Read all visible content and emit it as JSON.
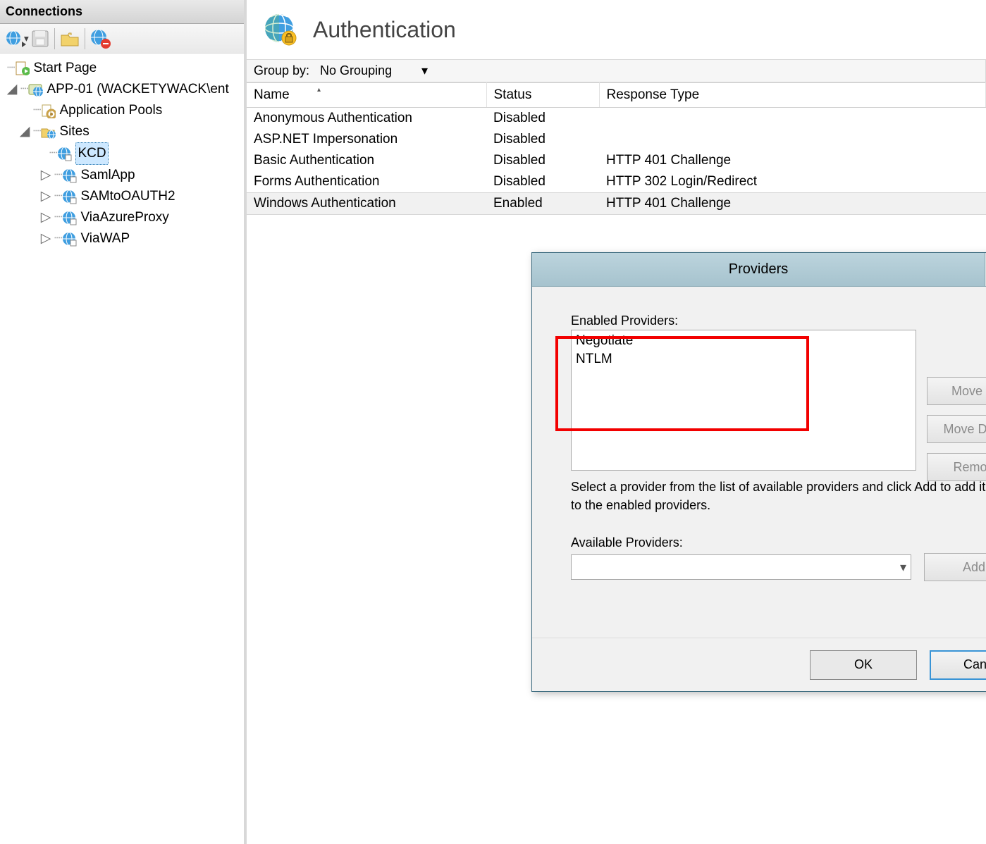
{
  "connections": {
    "header": "Connections",
    "tree": {
      "start_page": "Start Page",
      "server": "APP-01 (WACKETYWACK\\ent",
      "app_pools": "Application Pools",
      "sites_label": "Sites",
      "sites": [
        "KCD",
        "SamlApp",
        "SAMtoOAUTH2",
        "ViaAzureProxy",
        "ViaWAP"
      ]
    }
  },
  "main": {
    "title": "Authentication",
    "group_by_label": "Group by:",
    "group_by_value": "No Grouping",
    "columns": {
      "name": "Name",
      "status": "Status",
      "response": "Response Type"
    },
    "rows": [
      {
        "name": "Anonymous Authentication",
        "status": "Disabled",
        "response": ""
      },
      {
        "name": "ASP.NET Impersonation",
        "status": "Disabled",
        "response": ""
      },
      {
        "name": "Basic Authentication",
        "status": "Disabled",
        "response": "HTTP 401 Challenge"
      },
      {
        "name": "Forms Authentication",
        "status": "Disabled",
        "response": "HTTP 302 Login/Redirect"
      },
      {
        "name": "Windows Authentication",
        "status": "Enabled",
        "response": "HTTP 401 Challenge"
      }
    ]
  },
  "dialog": {
    "title": "Providers",
    "enabled_label": "Enabled Providers:",
    "enabled_items": [
      "Negotiate",
      "NTLM"
    ],
    "instructions": "Select a provider from the list of available providers and click Add to add it to the enabled providers.",
    "available_label": "Available Providers:",
    "available_value": "",
    "buttons": {
      "move_up": "Move Up",
      "move_down": "Move Down",
      "remove": "Remove",
      "add": "Add",
      "ok": "OK",
      "cancel": "Cancel"
    }
  }
}
